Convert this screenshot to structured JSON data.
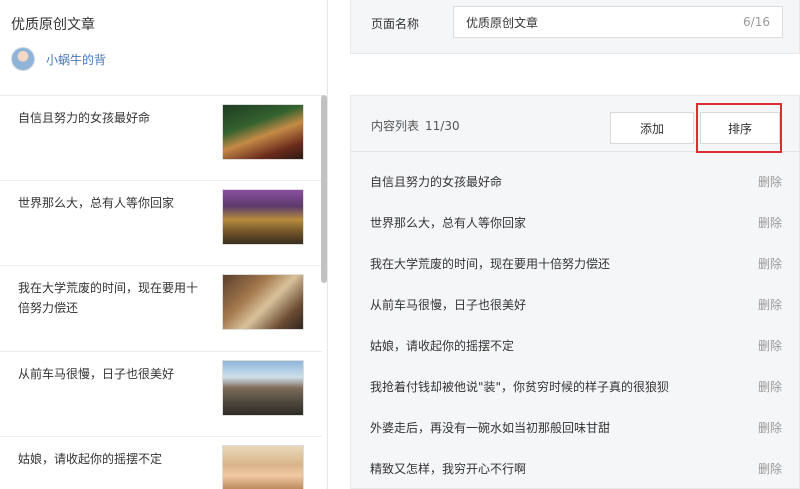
{
  "preview": {
    "page_title": "优质原创文章",
    "author_name": "小蜗牛的背",
    "articles": [
      {
        "title": "自信且努力的女孩最好命"
      },
      {
        "title": "世界那么大，总有人等你回家"
      },
      {
        "title": "我在大学荒废的时间，现在要用十倍努力偿还"
      },
      {
        "title": "从前车马很慢，日子也很美好"
      },
      {
        "title": "姑娘，请收起你的摇摆不定"
      }
    ]
  },
  "settings": {
    "name_label": "页面名称",
    "name_value": "优质原创文章",
    "name_counter": "6/16",
    "list_label": "内容列表",
    "list_count": "11/30",
    "add_label": "添加",
    "sort_label": "排序",
    "delete_label": "删除",
    "items": [
      "自信且努力的女孩最好命",
      "世界那么大，总有人等你回家",
      "我在大学荒废的时间，现在要用十倍努力偿还",
      "从前车马很慢，日子也很美好",
      "姑娘，请收起你的摇摆不定",
      "我抢着付钱却被他说\"装\"，你贫穷时候的样子真的很狼狈",
      "外婆走后，再没有一碗水如当初那般回味甘甜",
      "精致又怎样，我穷开心不行啊"
    ]
  },
  "colors": {
    "highlight": "#d9302f",
    "author_link": "#4a77b8",
    "panel_bg": "#f5f6f8"
  }
}
